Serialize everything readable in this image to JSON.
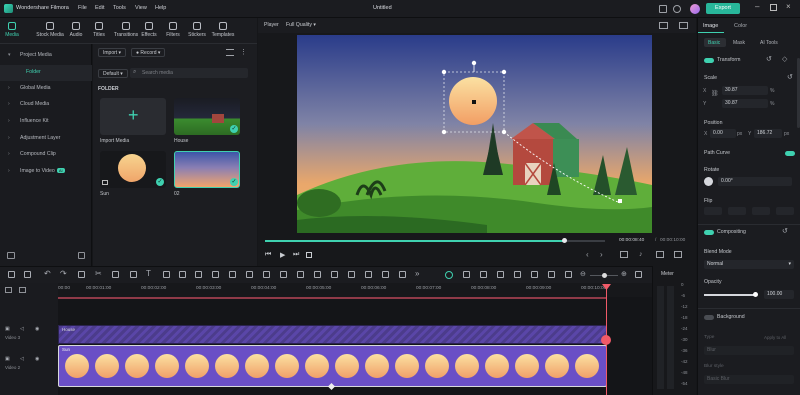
{
  "app": {
    "name": "Wondershare Filmora",
    "menu": [
      "File",
      "Edit",
      "Tools",
      "View",
      "Help"
    ],
    "title": "Untitled",
    "export_label": "Export"
  },
  "toolbar": [
    "Media",
    "Stock Media",
    "Audio",
    "Titles",
    "Transitions",
    "Effects",
    "Filters",
    "Stickers",
    "Templates"
  ],
  "leftnav": [
    {
      "label": "Project Media",
      "arrow": "▾"
    },
    {
      "label": "Folder",
      "arrow": ""
    },
    {
      "label": "Global Media",
      "arrow": "›"
    },
    {
      "label": "Cloud Media",
      "arrow": "›"
    },
    {
      "label": "Influence Kit",
      "arrow": "›"
    },
    {
      "label": "Adjustment Layer",
      "arrow": "›"
    },
    {
      "label": "Compound Clip",
      "arrow": "›"
    },
    {
      "label": "Image to Video",
      "arrow": "›",
      "badge": "AI"
    }
  ],
  "media": {
    "import_label": "Import",
    "record_label": "Record",
    "default_label": "Default",
    "search_placeholder": "Search media",
    "folder_label": "FOLDER",
    "items": [
      {
        "label": "Import Media"
      },
      {
        "label": "House"
      },
      {
        "label": "Sun"
      },
      {
        "label": "02"
      }
    ]
  },
  "player": {
    "label": "Player",
    "quality": "Full Quality",
    "time_current": "00:00:08:40",
    "time_total": "00:00:10:00",
    "progress": 0.88
  },
  "props": {
    "tabs": [
      "Image",
      "Color"
    ],
    "subtabs": [
      "Basic",
      "Mask",
      "AI Tools"
    ],
    "transform": "Transform",
    "scale": "Scale",
    "scale_x": "30.87",
    "scale_y": "30.87",
    "pct": "%",
    "position": "Position",
    "pos_x": "0.00",
    "pos_y": "186.72",
    "px": "px",
    "x_label": "X",
    "y_label": "Y",
    "path_curve": "Path Curve",
    "rotate": "Rotate",
    "rotate_val": "0.00°",
    "flip": "Flip",
    "compositing": "Compositing",
    "blend_mode": "Blend Mode",
    "blend_val": "Normal",
    "opacity": "Opacity",
    "opacity_val": "100.00",
    "opacity_level": 1.0,
    "background": "Background",
    "bg_type": "Type",
    "bg_apply": "Apply to All",
    "bg_type_val": "Blur",
    "bg_blur_style": "Blur style",
    "bg_blur_val": "Basic Blur"
  },
  "timeline": {
    "ticks": [
      "00:00",
      "00:00:01:00",
      "00:00:02:00",
      "00:00:03:00",
      "00:00:04:00",
      "00:00:05:00",
      "00:00:06:00",
      "00:00:07:00",
      "00:00:08:00",
      "00:00:09:00",
      "00:00:10:00"
    ],
    "track1": "Video 3",
    "track2": "Video 2",
    "clip1": "House",
    "clip2": "Sun",
    "meter": "Meter",
    "meter_vals": [
      "0",
      "-6",
      "-12",
      "-18",
      "-24",
      "-30",
      "-36",
      "-42",
      "-48",
      "-54"
    ]
  },
  "colors": {
    "accent": "#3fd1b0",
    "sun_clip": "#6a4fc6",
    "playhead": "#f05a68"
  }
}
